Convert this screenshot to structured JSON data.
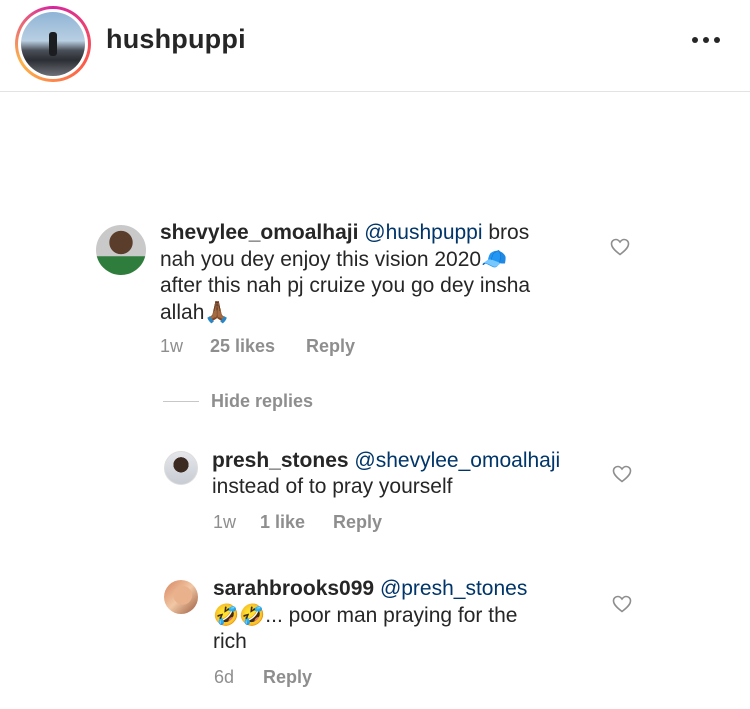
{
  "header": {
    "username": "hushpuppi",
    "more_icon": "more-horizontal-icon"
  },
  "comments": [
    {
      "username": "shevylee_omoalhaji",
      "mention": "@hushpuppi",
      "text_line1": " bros",
      "text_line2": "nah you dey enjoy this vision 2020",
      "emoji1": "🧢",
      "text_line3": "after this nah pj cruize you go dey insha",
      "text_line4": "allah",
      "emoji2": "🙏🏾",
      "time": "1w",
      "likes": "25 likes",
      "reply": "Reply"
    }
  ],
  "hide_replies_label": "Hide replies",
  "replies": [
    {
      "username": "presh_stones",
      "mention": "@shevylee_omoalhaji",
      "text_line2": "instead of to pray yourself",
      "time": "1w",
      "likes": "1 like",
      "reply": "Reply"
    },
    {
      "username": "sarahbrooks099",
      "mention": "@presh_stones",
      "emoji": "🤣🤣",
      "text_line2": "... poor man praying for the",
      "text_line3": "rich",
      "time": "6d",
      "reply": "Reply"
    }
  ]
}
